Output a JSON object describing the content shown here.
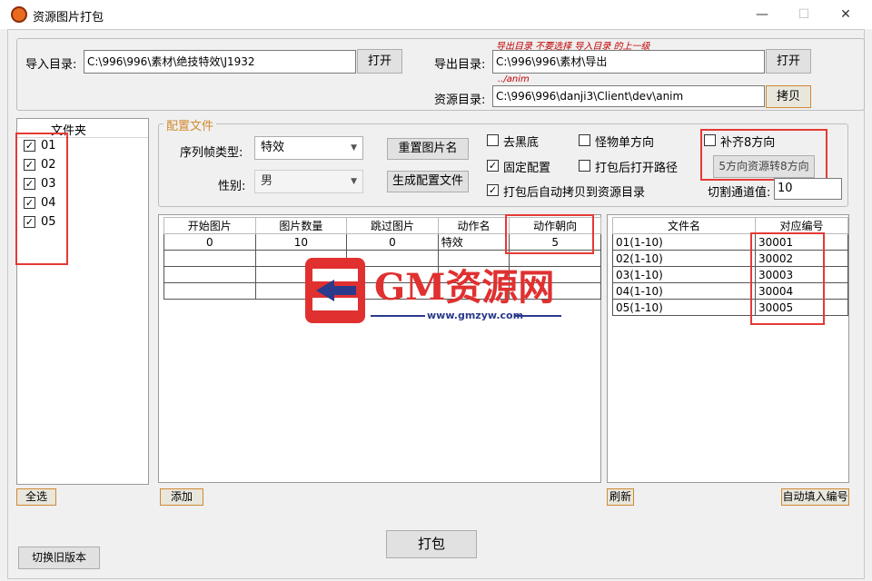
{
  "window": {
    "title": "资源图片打包",
    "minimize": "—",
    "maximize": "☐",
    "close": "✕"
  },
  "paths": {
    "import_label": "导入目录:",
    "import_value": "C:\\996\\996\\素材\\绝技特效\\J1932",
    "import_btn": "打开",
    "export_label": "导出目录:",
    "export_value": "C:\\996\\996\\素材\\导出",
    "export_btn": "打开",
    "export_note": "导出目录 不要选择 导入目录 的上一级",
    "anim_note": "../anim",
    "resource_label": "资源目录:",
    "resource_value": "C:\\996\\996\\danji3\\Client\\dev\\anim",
    "copy_btn": "拷贝"
  },
  "folders": {
    "header": "文件夹",
    "items": [
      {
        "label": "01",
        "checked": true
      },
      {
        "label": "02",
        "checked": true
      },
      {
        "label": "03",
        "checked": true
      },
      {
        "label": "04",
        "checked": true
      },
      {
        "label": "05",
        "checked": true
      }
    ],
    "select_all": "全选"
  },
  "config": {
    "legend": "配置文件",
    "frame_type_label": "序列帧类型:",
    "frame_type_value": "特效",
    "gender_label": "性别:",
    "gender_value": "男",
    "reset_btn": "重置图片名",
    "gen_btn": "生成配置文件",
    "chk_remove_black": "去黑底",
    "chk_fixed": "固定配置",
    "chk_auto_copy": "打包后自动拷贝到资源目录",
    "chk_monster": "怪物单方向",
    "chk_open_path": "打包后打开路径",
    "chk_8dir": "补齐8方向",
    "convert_btn": "5方向资源转8方向",
    "cut_label": "切割通道值:",
    "cut_value": "10"
  },
  "anim_table": {
    "headers": [
      "开始图片",
      "图片数量",
      "跳过图片",
      "动作名",
      "动作朝向"
    ],
    "rows": [
      [
        "0",
        "10",
        "0",
        "特效",
        "5"
      ]
    ],
    "add_btn": "添加"
  },
  "file_table": {
    "headers": [
      "文件名",
      "对应编号"
    ],
    "rows": [
      [
        "01(1-10)",
        "30001"
      ],
      [
        "02(1-10)",
        "30002"
      ],
      [
        "03(1-10)",
        "30003"
      ],
      [
        "04(1-10)",
        "30004"
      ],
      [
        "05(1-10)",
        "30005"
      ]
    ],
    "refresh_btn": "刷新",
    "autofill_btn": "自动填入编号"
  },
  "watermark": {
    "brand": "GM资源网",
    "url": "www.gmzyw.com"
  },
  "footer": {
    "pack_btn": "打包",
    "old_version_btn": "切换旧版本"
  },
  "colors": {
    "accent_orange": "#d08a30",
    "highlight_red": "#e53935",
    "note_red": "#c00000"
  }
}
